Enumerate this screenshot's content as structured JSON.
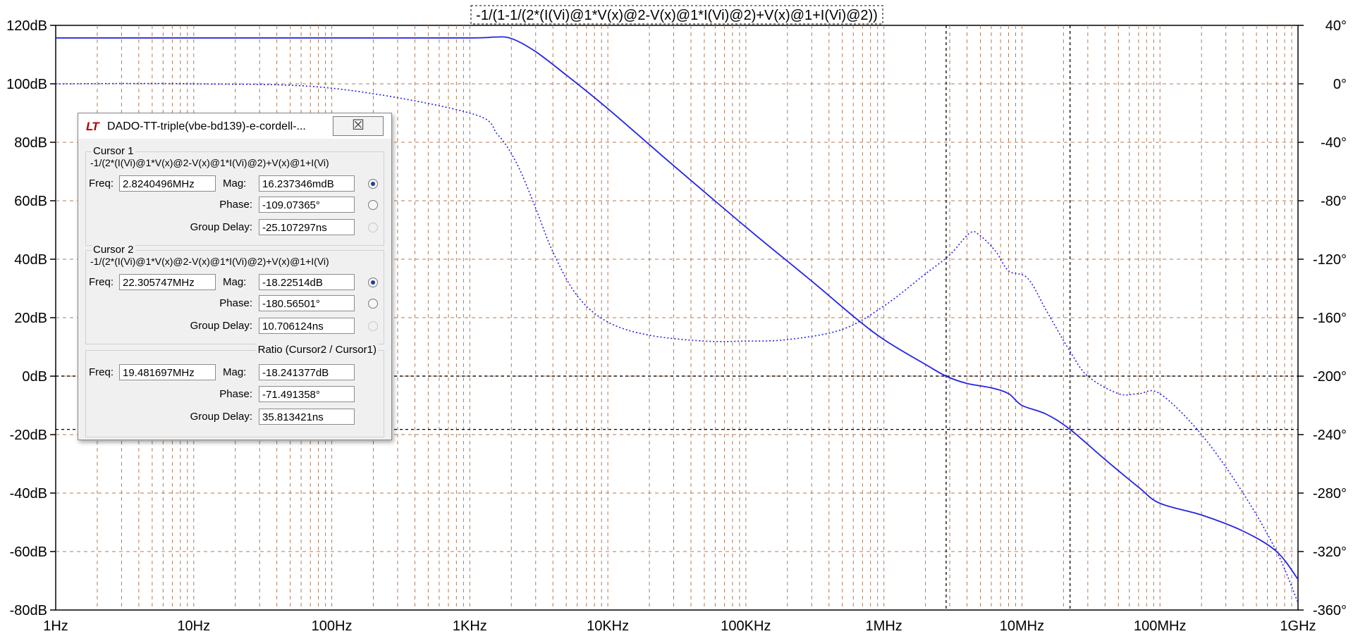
{
  "chart_data": {
    "type": "line",
    "title": "-1/(1-1/(2*(I(Vi)@1*V(x)@2-V(x)@1*I(Vi)@2)+V(x)@1+I(Vi)@2))",
    "x_scale": "log",
    "xlim": [
      1,
      1000000000
    ],
    "x_ticks": [
      1,
      10,
      100,
      1000,
      10000,
      100000,
      1000000,
      10000000,
      100000000,
      1000000000
    ],
    "x_tick_labels": [
      "1Hz",
      "10Hz",
      "100Hz",
      "1KHz",
      "10KHz",
      "100KHz",
      "1MHz",
      "10MHz",
      "100MHz",
      "1GHz"
    ],
    "ylim_left": [
      -80,
      120
    ],
    "y_left_ticks": [
      120,
      100,
      80,
      60,
      40,
      20,
      0,
      -20,
      -40,
      -60,
      -80
    ],
    "y_left_tick_labels": [
      "120dB",
      "100dB",
      "80dB",
      "60dB",
      "40dB",
      "20dB",
      "0dB",
      "-20dB",
      "-40dB",
      "-60dB",
      "-80dB"
    ],
    "ylim_right": [
      -360,
      40
    ],
    "y_right_ticks": [
      40,
      0,
      -40,
      -80,
      -120,
      -160,
      -200,
      -240,
      -280,
      -320,
      -360
    ],
    "y_right_tick_labels": [
      "40°",
      "0°",
      "-40°",
      "-80°",
      "-120°",
      "-160°",
      "-200°",
      "-240°",
      "-280°",
      "-320°",
      "-360°"
    ],
    "grid": true,
    "series": [
      {
        "axis": "left",
        "style": "solid",
        "color": "#2323e6",
        "x": [
          1,
          10,
          100,
          1000,
          1500,
          2000,
          3000,
          5000,
          10000,
          30000,
          100000,
          300000,
          600000,
          1000000,
          2000000,
          2824000,
          4000000,
          6000000,
          8000000,
          10000000,
          15000000,
          22300000,
          40000000,
          70000000,
          100000000,
          200000000,
          400000000,
          700000000,
          1000000000
        ],
        "y": [
          115.7,
          115.7,
          115.7,
          115.7,
          116.0,
          115.5,
          111.0,
          103.0,
          91.5,
          72.0,
          51.0,
          32.5,
          20.5,
          12.5,
          4.0,
          0.0,
          -2.5,
          -4.0,
          -6.0,
          -10.0,
          -13.0,
          -18.2,
          -28.5,
          -38.0,
          -43.5,
          -47.5,
          -53.0,
          -60.0,
          -69.5
        ]
      },
      {
        "axis": "right",
        "style": "dotted",
        "color": "#2323e6",
        "x": [
          1,
          10,
          100,
          1000,
          1600,
          2200,
          3000,
          4000,
          6000,
          10000,
          20000,
          50000,
          100000,
          200000,
          500000,
          1000000,
          2000000,
          3000000,
          4200000,
          5000000,
          6500000,
          8000000,
          11000000,
          15000000,
          22300000,
          30000000,
          50000000,
          70000000,
          100000000,
          200000000,
          400000000,
          700000000,
          1000000000
        ],
        "y": [
          0,
          0,
          -3,
          -20,
          -35,
          -55,
          -85,
          -115,
          -145,
          -163,
          -172,
          -176,
          -176,
          -175,
          -168,
          -152,
          -130,
          -117,
          -102,
          -104,
          -115,
          -128,
          -133,
          -155,
          -183,
          -200,
          -212,
          -212,
          -212,
          -240,
          -280,
          -320,
          -355
        ]
      }
    ],
    "cursors": [
      {
        "freq_hz": 2824049.6,
        "mag_db": 0.016
      },
      {
        "freq_hz": 22305747,
        "mag_db": -18.22514
      }
    ]
  },
  "dialog": {
    "title": "DADO-TT-triple(vbe-bd139)-e-cordell-...",
    "logo": "LT",
    "close_symbol": "☒",
    "cursor1": {
      "label": "Cursor 1",
      "expr": "-1/(2*(I(Vi)@1*V(x)@2-V(x)@1*I(Vi)@2)+V(x)@1+I(Vi)",
      "freq_label": "Freq:",
      "freq": "2.8240496MHz",
      "mag_label": "Mag:",
      "mag": "16.237346mdB",
      "phase_label": "Phase:",
      "phase": "-109.07365°",
      "gd_label": "Group Delay:",
      "gd": "-25.107297ns"
    },
    "cursor2": {
      "label": "Cursor 2",
      "expr": "-1/(2*(I(Vi)@1*V(x)@2-V(x)@1*I(Vi)@2)+V(x)@1+I(Vi)",
      "freq_label": "Freq:",
      "freq": "22.305747MHz",
      "mag_label": "Mag:",
      "mag": "-18.22514dB",
      "phase_label": "Phase:",
      "phase": "-180.56501°",
      "gd_label": "Group Delay:",
      "gd": "10.706124ns"
    },
    "ratio": {
      "label": "Ratio (Cursor2 / Cursor1)",
      "freq_label": "Freq:",
      "freq": "19.481697MHz",
      "mag_label": "Mag:",
      "mag": "-18.241377dB",
      "phase_label": "Phase:",
      "phase": "-71.491358°",
      "gd_label": "Group Delay:",
      "gd": "35.813421ns"
    }
  }
}
